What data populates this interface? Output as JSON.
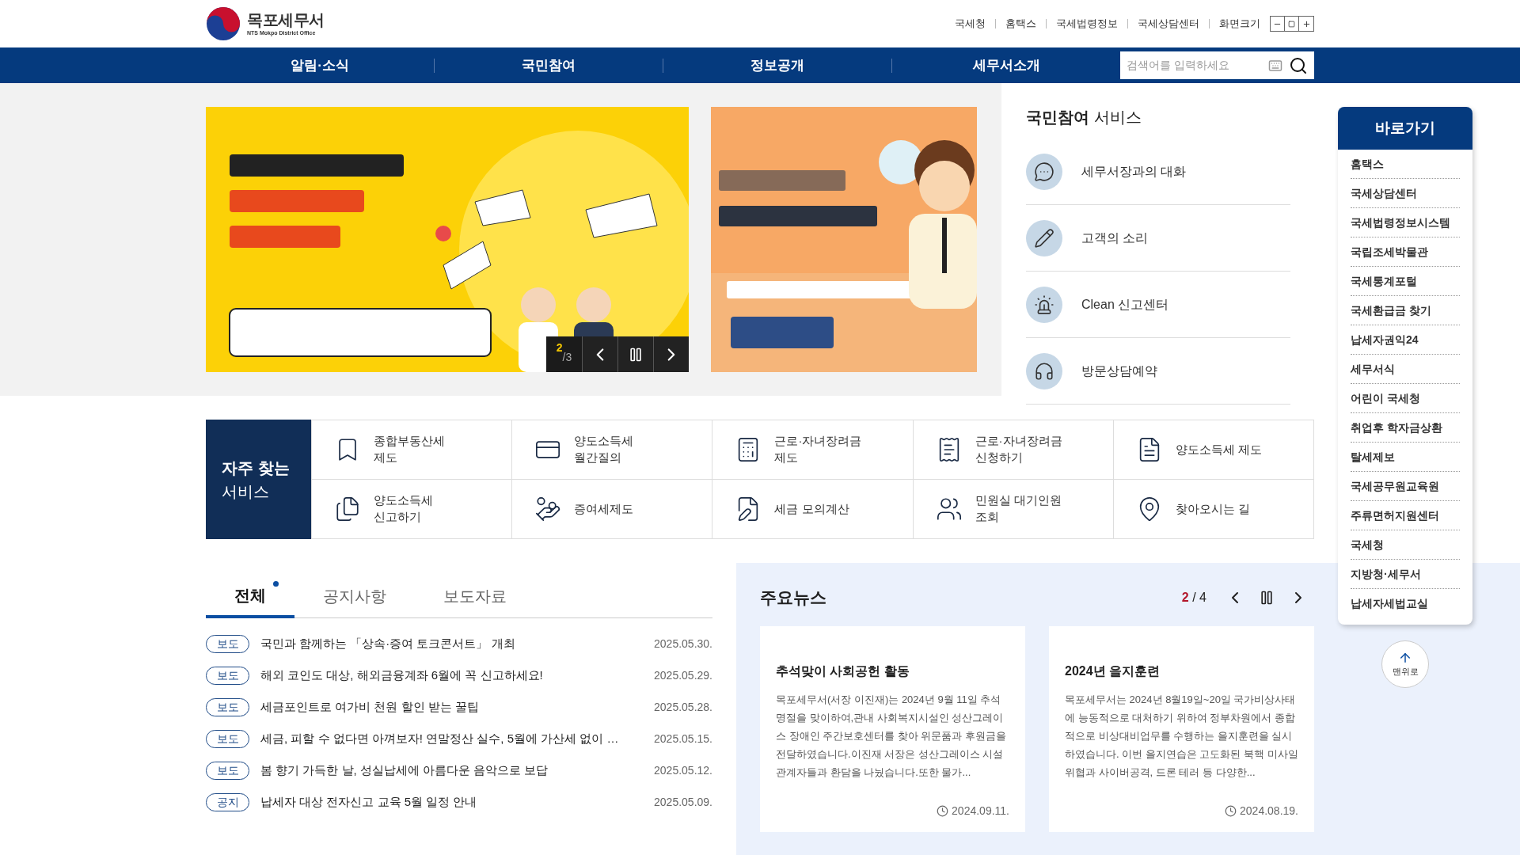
{
  "header": {
    "logo_title": "목포세무서",
    "logo_subtitle": "NTS Mokpo District Office",
    "top_links": [
      "국세청",
      "홈택스",
      "국세법령정보",
      "국세상담센터"
    ],
    "font_size_label": "화면크기"
  },
  "nav": {
    "items": [
      "알림·소식",
      "국민참여",
      "정보공개",
      "세무서소개"
    ],
    "search_placeholder": "검색어를 입력하세요"
  },
  "banner_slider": {
    "current": "2",
    "separator": "/",
    "total": "3"
  },
  "services": {
    "title_bold": "국민참여",
    "title_rest": "서비스",
    "items": [
      "세무서장과의 대화",
      "고객의 소리",
      "Clean 신고센터",
      "방문상담예약"
    ]
  },
  "frequent": {
    "title_line1": "자주 찾는",
    "title_line2": "서비스",
    "items": [
      {
        "lines": [
          "종합부동산세",
          "제도"
        ]
      },
      {
        "lines": [
          "양도소득세",
          "월간질의"
        ]
      },
      {
        "lines": [
          "근로·자녀장려금",
          "제도"
        ]
      },
      {
        "lines": [
          "근로·자녀장려금",
          "신청하기"
        ]
      },
      {
        "lines": [
          "양도소득세 제도"
        ]
      },
      {
        "lines": [
          "양도소득세",
          "신고하기"
        ]
      },
      {
        "lines": [
          "증여세제도"
        ]
      },
      {
        "lines": [
          "세금 모의계산"
        ]
      },
      {
        "lines": [
          "민원실 대기인원",
          "조회"
        ]
      },
      {
        "lines": [
          "찾아오시는 길"
        ]
      }
    ]
  },
  "quick_links": {
    "title": "바로가기",
    "items": [
      "홈택스",
      "국세상담센터",
      "국세법령정보시스템",
      "국립조세박물관",
      "국세통계포털",
      "국세환급금 찾기",
      "납세자권익24",
      "세무서식",
      "어린이 국세청",
      "취업후 학자금상환",
      "탈세제보",
      "국세공무원교육원",
      "주류면허지원센터",
      "국세청",
      "지방청·세무서",
      "납세자세법교실"
    ],
    "top_button": "맨위로"
  },
  "news_tabs": [
    {
      "label": "전체",
      "selected": true,
      "new": true
    },
    {
      "label": "공지사항",
      "selected": false,
      "new": false
    },
    {
      "label": "보도자료",
      "selected": false,
      "new": false
    }
  ],
  "news": [
    {
      "tag": "보도",
      "title": "국민과 함께하는 「상속·증여 토크콘서트」 개최",
      "date": "2025.05.30."
    },
    {
      "tag": "보도",
      "title": "해외 코인도 대상, 해외금융계좌 6월에 꼭 신고하세요!",
      "date": "2025.05.29."
    },
    {
      "tag": "보도",
      "title": "세금포인트로 여가비 천원 할인 받는 꿀팁",
      "date": "2025.05.28."
    },
    {
      "tag": "보도",
      "title": "세금, 피할 수 없다면 아껴보자! 연말정산 실수, 5월에 가산세 없이 …",
      "date": "2025.05.15."
    },
    {
      "tag": "보도",
      "title": "봄 향기 가득한 날, 성실납세에 아름다운 음악으로 보답",
      "date": "2025.05.12."
    },
    {
      "tag": "공지",
      "title": "납세자 대상 전자신고 교육 5월 일정 안내",
      "date": "2025.05.09."
    }
  ],
  "main_news": {
    "title": "주요뉴스",
    "current": "2",
    "separator": "/",
    "total": "4",
    "cards": [
      {
        "title": "추석맞이 사회공헌 활동",
        "body": "목포세무서(서장 이진재)는 2024년 9월 11일 추석 명절을 맞이하여,관내 사회복지시설인 성산그레이스 장애인 주간보호센터를 찾아 위문품과 후원금을 전달하였습니다.이진재 서장은 성산그레이스 시설 관계자들과 환담을 나눴습니다.또한 물가...",
        "date": "2024.09.11."
      },
      {
        "title": "2024년 을지훈련",
        "body": "목포세무서는 2024년 8월19일~20일 국가비상사태에 능동적으로 대처하기 위하여 정부차원에서 종합적으로 비상대비업무를 수행하는 을지훈련을 실시하였습니다. 이번 을지연습은 고도화된 북핵 미사일 위협과 사이버공격, 드론 테러 등 다양한...",
        "date": "2024.08.19."
      }
    ]
  }
}
